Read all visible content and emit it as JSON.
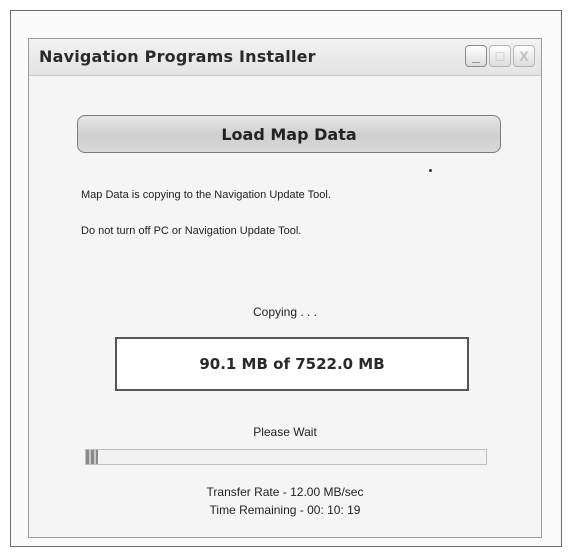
{
  "window": {
    "title": "Navigation Programs Installer",
    "controls": {
      "minimize": "_",
      "maximize": "□",
      "close": "X"
    }
  },
  "load_button": {
    "label": "Load Map Data"
  },
  "messages": {
    "copying_notice": "Map Data is copying to the Navigation Update Tool.",
    "warning": "Do not turn off PC or Navigation Update Tool."
  },
  "status": {
    "copying": "Copying . . .",
    "size_progress": "90.1 MB of 7522.0 MB",
    "please_wait": "Please Wait",
    "transfer_rate": "Transfer Rate - 12.00 MB/sec",
    "time_remaining": "Time Remaining - 00: 10: 19"
  },
  "progress": {
    "fraction": 0.012
  }
}
